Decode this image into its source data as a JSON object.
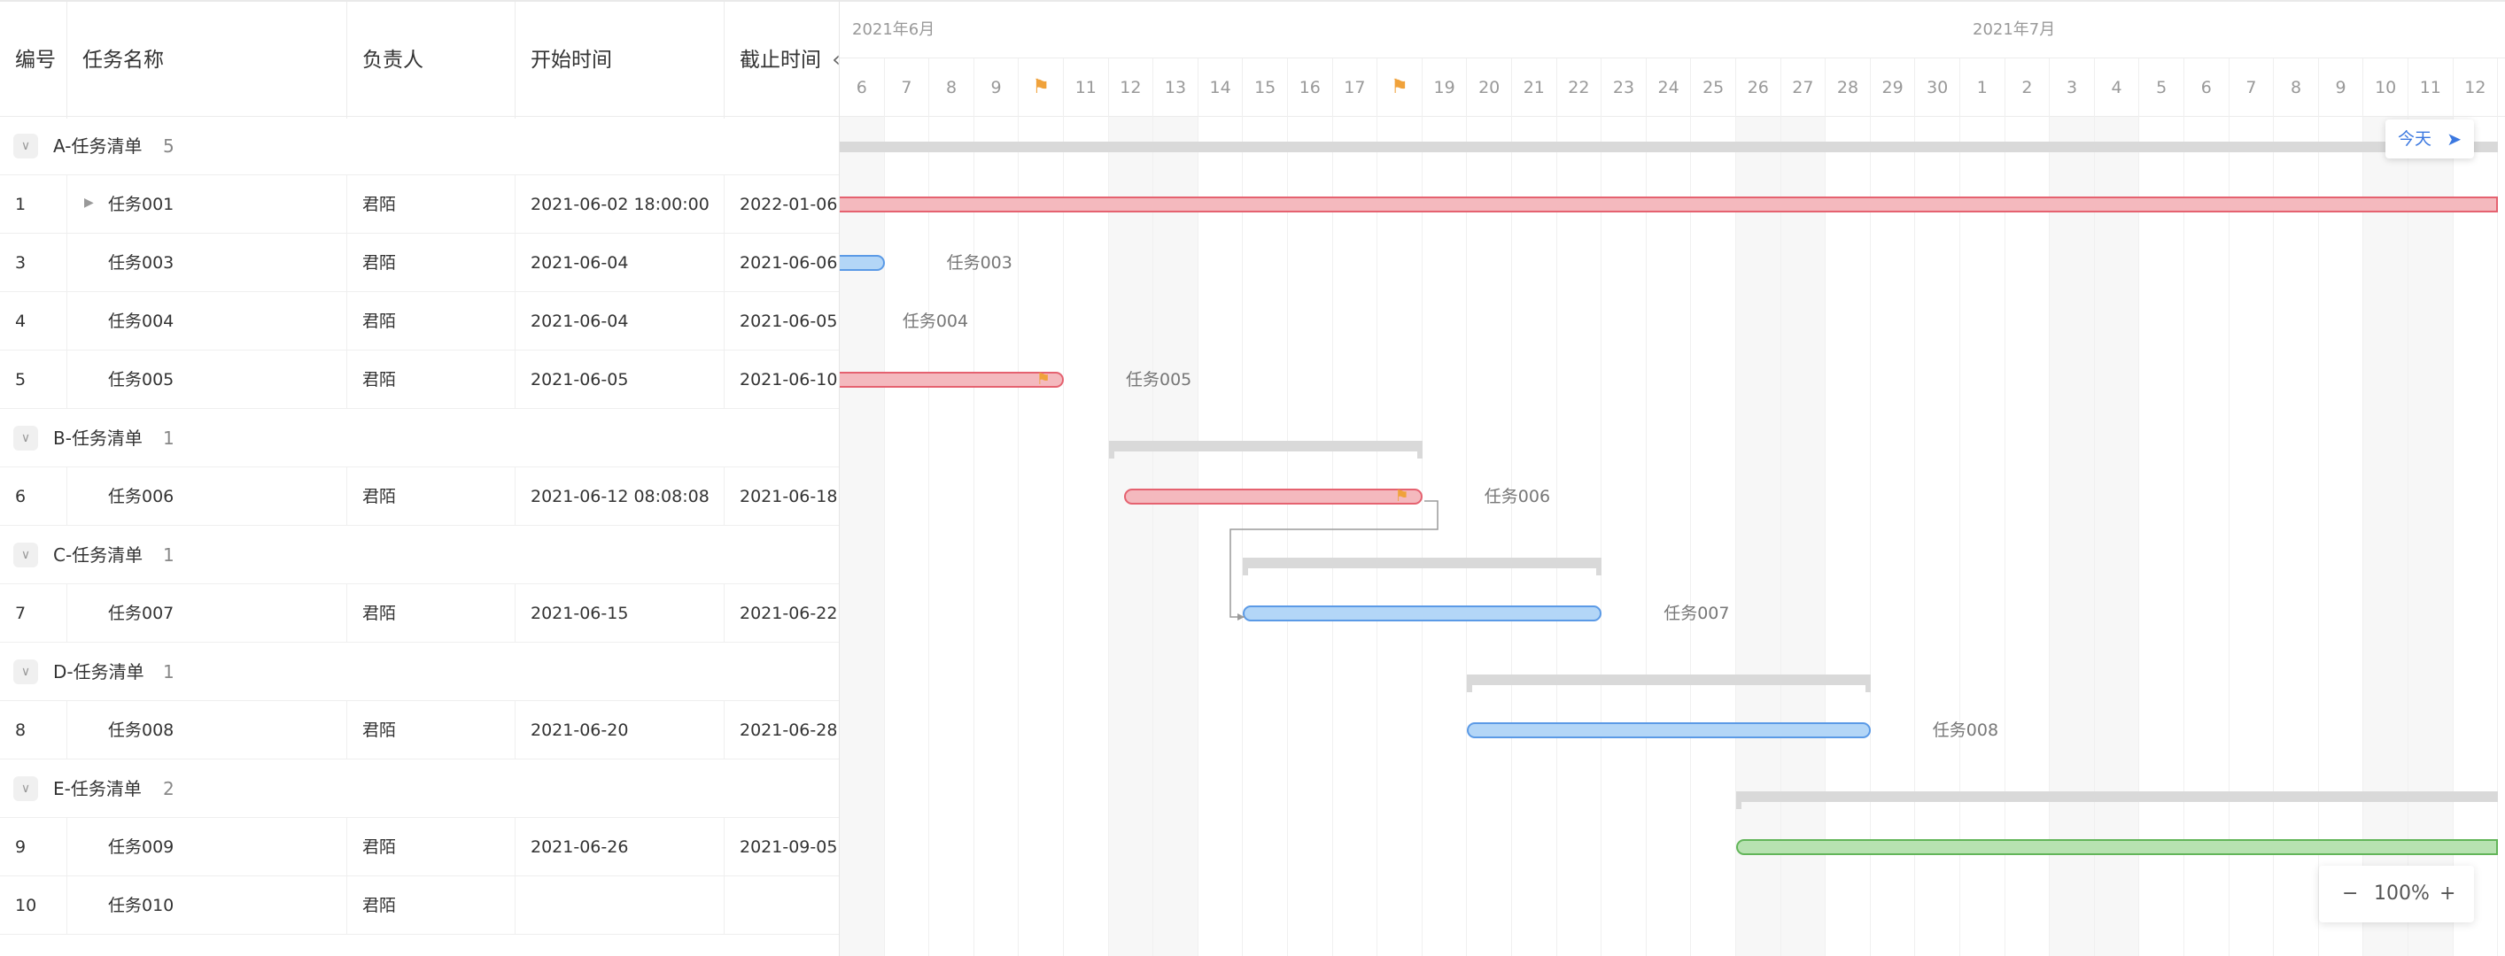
{
  "table": {
    "headers": {
      "id": "编号",
      "name": "任务名称",
      "owner": "负责人",
      "start": "开始时间",
      "end": "截止时间"
    },
    "collapse_icon": "chevron-left-icon",
    "rows": [
      {
        "type": "group",
        "name": "A-任务清单",
        "count": "5"
      },
      {
        "type": "task",
        "id": "1",
        "name": "任务001",
        "owner": "君陌",
        "start": "2021-06-02 18:00:00",
        "end": "2022-01-06",
        "expand": true
      },
      {
        "type": "task",
        "id": "3",
        "name": "任务003",
        "owner": "君陌",
        "start": "2021-06-04",
        "end": "2021-06-06"
      },
      {
        "type": "task",
        "id": "4",
        "name": "任务004",
        "owner": "君陌",
        "start": "2021-06-04",
        "end": "2021-06-05"
      },
      {
        "type": "task",
        "id": "5",
        "name": "任务005",
        "owner": "君陌",
        "start": "2021-06-05",
        "end": "2021-06-10"
      },
      {
        "type": "group",
        "name": "B-任务清单",
        "count": "1"
      },
      {
        "type": "task",
        "id": "6",
        "name": "任务006",
        "owner": "君陌",
        "start": "2021-06-12 08:08:08",
        "end": "2021-06-18"
      },
      {
        "type": "group",
        "name": "C-任务清单",
        "count": "1"
      },
      {
        "type": "task",
        "id": "7",
        "name": "任务007",
        "owner": "君陌",
        "start": "2021-06-15",
        "end": "2021-06-22"
      },
      {
        "type": "group",
        "name": "D-任务清单",
        "count": "1"
      },
      {
        "type": "task",
        "id": "8",
        "name": "任务008",
        "owner": "君陌",
        "start": "2021-06-20",
        "end": "2021-06-28"
      },
      {
        "type": "group",
        "name": "E-任务清单",
        "count": "2"
      },
      {
        "type": "task",
        "id": "9",
        "name": "任务009",
        "owner": "君陌",
        "start": "2021-06-26",
        "end": "2021-09-05"
      },
      {
        "type": "task",
        "id": "10",
        "name": "任务010",
        "owner": "君陌",
        "start": "",
        "end": ""
      }
    ]
  },
  "gantt": {
    "months": [
      {
        "label": "2021年6月",
        "first_day": 6
      },
      {
        "label": "2021年7月",
        "first_day": 1
      }
    ],
    "days": [
      {
        "d": "6",
        "w": true
      },
      {
        "d": "7",
        "w": false
      },
      {
        "d": "8",
        "w": false
      },
      {
        "d": "9",
        "w": false
      },
      {
        "d": "flag",
        "w": false,
        "holiday": true
      },
      {
        "d": "11",
        "w": false
      },
      {
        "d": "12",
        "w": true
      },
      {
        "d": "13",
        "w": true
      },
      {
        "d": "14",
        "w": false
      },
      {
        "d": "15",
        "w": false
      },
      {
        "d": "16",
        "w": false
      },
      {
        "d": "17",
        "w": false
      },
      {
        "d": "flag",
        "w": false,
        "holiday": true
      },
      {
        "d": "19",
        "w": false
      },
      {
        "d": "20",
        "w": false
      },
      {
        "d": "21",
        "w": false
      },
      {
        "d": "22",
        "w": false
      },
      {
        "d": "23",
        "w": false
      },
      {
        "d": "24",
        "w": false
      },
      {
        "d": "25",
        "w": false
      },
      {
        "d": "26",
        "w": true
      },
      {
        "d": "27",
        "w": true
      },
      {
        "d": "28",
        "w": false
      },
      {
        "d": "29",
        "w": false
      },
      {
        "d": "30",
        "w": false
      },
      {
        "d": "1",
        "w": false
      },
      {
        "d": "2",
        "w": false
      },
      {
        "d": "3",
        "w": true
      },
      {
        "d": "4",
        "w": true
      },
      {
        "d": "5",
        "w": false
      },
      {
        "d": "6",
        "w": false
      },
      {
        "d": "7",
        "w": false
      },
      {
        "d": "8",
        "w": false
      },
      {
        "d": "9",
        "w": false
      },
      {
        "d": "10",
        "w": true
      },
      {
        "d": "11",
        "w": true
      },
      {
        "d": "12",
        "w": false
      }
    ],
    "holiday_icon": "flag-icon",
    "bars": [
      {
        "row": 0,
        "kind": "parent",
        "from": 0,
        "to": 37
      },
      {
        "row": 1,
        "kind": "task",
        "color": "red",
        "from": 0,
        "to": 37
      },
      {
        "row": 2,
        "kind": "task",
        "color": "blue",
        "from": 0,
        "to": 1,
        "label": "任务003"
      },
      {
        "row": 3,
        "kind": "label",
        "at": 1.4,
        "label": "任务004"
      },
      {
        "row": 4,
        "kind": "task",
        "color": "red",
        "from": 0,
        "to": 5,
        "label": "任务005",
        "flag_at": 4.5
      },
      {
        "row": 5,
        "kind": "parent",
        "from": 6,
        "to": 13
      },
      {
        "row": 6,
        "kind": "task",
        "color": "red",
        "from": 6.35,
        "to": 13,
        "label": "任务006",
        "flag_at": 12.5
      },
      {
        "row": 7,
        "kind": "parent",
        "from": 9,
        "to": 17
      },
      {
        "row": 8,
        "kind": "task",
        "color": "blue",
        "from": 9,
        "to": 17,
        "label": "任务007"
      },
      {
        "row": 9,
        "kind": "parent",
        "from": 14,
        "to": 23
      },
      {
        "row": 10,
        "kind": "task",
        "color": "blue",
        "from": 14,
        "to": 23,
        "label": "任务008"
      },
      {
        "row": 11,
        "kind": "parent",
        "from": 20,
        "to": 37
      },
      {
        "row": 12,
        "kind": "task",
        "color": "green",
        "from": 20,
        "to": 37
      }
    ],
    "today_label": "今天",
    "today_icon": "send-arrow-icon",
    "zoom": {
      "minus": "−",
      "value": "100%",
      "plus": "+"
    },
    "colors": {
      "red": "#e56270",
      "blue": "#5b9ae6",
      "green": "#62b559",
      "holiday": "#f0a23b",
      "today": "#3b78e0"
    }
  }
}
